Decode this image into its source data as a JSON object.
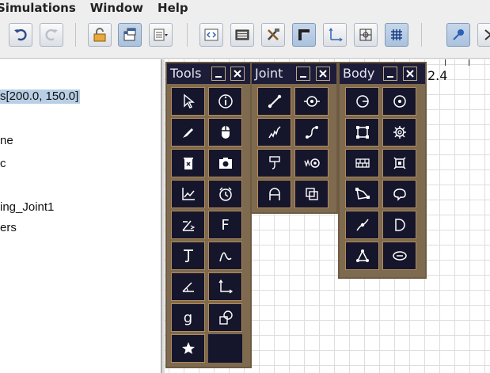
{
  "menubar": {
    "items": [
      "Simulations",
      "Window",
      "Help"
    ]
  },
  "toolbar": {
    "buttons": [
      {
        "name": "undo-icon"
      },
      {
        "name": "redo-icon"
      },
      {
        "name": "lock-icon"
      },
      {
        "name": "window-icon"
      },
      {
        "name": "list-dropdown-icon"
      },
      {
        "name": "code-icon"
      },
      {
        "name": "keyboard-icon"
      },
      {
        "name": "tools-icon"
      },
      {
        "name": "ruler-icon"
      },
      {
        "name": "axes-icon"
      },
      {
        "name": "grid-target-icon"
      },
      {
        "name": "grid-icon"
      },
      {
        "name": "pin-icon"
      }
    ]
  },
  "tree": {
    "lines": [
      "s[200.0, 150.0]",
      "ne",
      "c",
      "ing_Joint1",
      "ers"
    ]
  },
  "canvas": {
    "ruler_value": "2.4"
  },
  "palettes": {
    "tools": {
      "title": "Tools",
      "icons": [
        "cursor-icon",
        "info-icon",
        "pencil-icon",
        "mouse-icon",
        "trash-icon",
        "camera-icon",
        "chart-icon",
        "clock-icon",
        "angle-measure-icon",
        "force-icon",
        "torque-icon",
        "curve-icon",
        "angle-icon",
        "axes-icon",
        "gravity-icon",
        "shapes-icon",
        "star-icon"
      ]
    },
    "joint": {
      "title": "Joint",
      "icons": [
        "line-joint-icon",
        "revolute-joint-icon",
        "spring-joint-icon",
        "rope-joint-icon",
        "pulley-joint-icon",
        "motor-joint-icon",
        "wheel-joint-icon",
        "weld-joint-icon"
      ]
    },
    "body": {
      "title": "Body",
      "icons": [
        "circle-icon",
        "circle-dot-icon",
        "square-body-icon",
        "gear-body-icon",
        "wall-icon",
        "frame-icon",
        "polygon-icon",
        "blob-icon",
        "pin-body-icon",
        "d-shape-icon",
        "triangle-node-icon",
        "chain-icon"
      ]
    }
  }
}
